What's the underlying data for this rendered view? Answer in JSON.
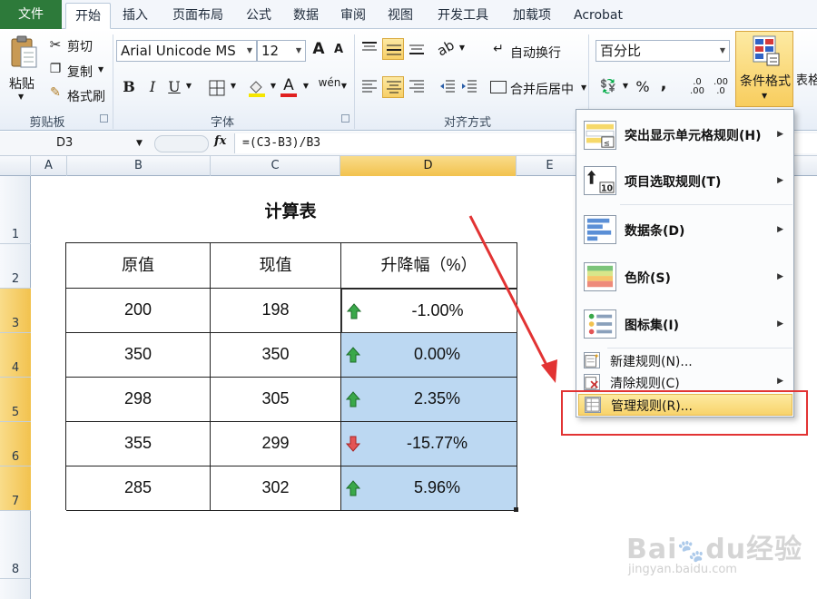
{
  "tabs": [
    "文件",
    "开始",
    "插入",
    "页面布局",
    "公式",
    "数据",
    "审阅",
    "视图",
    "开发工具",
    "加载项",
    "Acrobat"
  ],
  "ribbon": {
    "clipboard": {
      "paste": "粘贴",
      "cut": "剪切",
      "copy": "复制",
      "format_painter": "格式刷",
      "label": "剪贴板"
    },
    "font": {
      "name": "Arial Unicode MS",
      "size": "12",
      "bold": "B",
      "italic": "I",
      "underline": "U",
      "grow": "A",
      "shrink": "A",
      "phonetic": "wén",
      "label": "字体"
    },
    "alignment": {
      "wrap": "自动换行",
      "merge": "合并后居中",
      "label": "对齐方式"
    },
    "number": {
      "format": "百分比",
      "percent": "%",
      "comma": ","
    },
    "styles": {
      "conditional": "条件格式",
      "table": "表格"
    }
  },
  "formula_bar": {
    "name_box": "D3",
    "fx": "fx",
    "formula": "=(C3-B3)/B3"
  },
  "columns": [
    "A",
    "B",
    "C",
    "D",
    "E"
  ],
  "rows": [
    "1",
    "2",
    "3",
    "4",
    "5",
    "6",
    "7",
    "8"
  ],
  "sheet": {
    "title": "计算表",
    "headers": [
      "原值",
      "现值",
      "升降幅（%）"
    ],
    "data": [
      {
        "orig": "200",
        "cur": "198",
        "pct": "-1.00%",
        "trend": "up"
      },
      {
        "orig": "350",
        "cur": "350",
        "pct": "0.00%",
        "trend": "up"
      },
      {
        "orig": "298",
        "cur": "305",
        "pct": "2.35%",
        "trend": "up"
      },
      {
        "orig": "355",
        "cur": "299",
        "pct": "-15.77%",
        "trend": "down"
      },
      {
        "orig": "285",
        "cur": "302",
        "pct": "5.96%",
        "trend": "up"
      }
    ]
  },
  "menu": {
    "highlight": "突出显示单元格规则(H)",
    "top_bottom": "项目选取规则(T)",
    "data_bars": "数据条(D)",
    "color_scales": "色阶(S)",
    "icon_sets": "图标集(I)",
    "new_rule": "新建规则(N)...",
    "clear_rules": "清除规则(C)",
    "manage_rules": "管理规则(R)..."
  },
  "colors": {
    "accent_green": "#2d7a3a",
    "selection_blue": "#bcd8f2",
    "annotation_red": "#e23333",
    "up_arrow": "#3aa84a",
    "down_arrow": "#e35555"
  },
  "watermark": "Baidu经验 jingyan.baidu.com"
}
